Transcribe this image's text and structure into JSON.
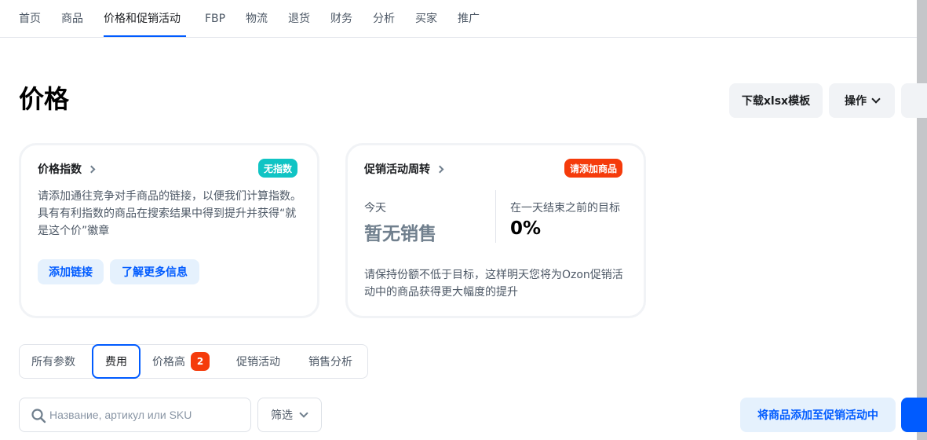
{
  "nav": {
    "tabs": [
      {
        "label": "首页"
      },
      {
        "label": "商品"
      },
      {
        "label": "价格和促销活动"
      },
      {
        "label": "FBP"
      },
      {
        "label": "物流"
      },
      {
        "label": "退货"
      },
      {
        "label": "财务"
      },
      {
        "label": "分析"
      },
      {
        "label": "买家"
      },
      {
        "label": "推广"
      }
    ],
    "active_tab": "价格和促销活动"
  },
  "header": {
    "title": "价格",
    "download_label": "下载xlsx模板",
    "actions_label": "操作"
  },
  "price_index_card": {
    "title": "价格指数",
    "badge": "无指数",
    "badge_color": "#10c4c4",
    "description": "请添加通往竞争对手商品的链接，以便我们计算指数。具有有利指数的商品在搜索结果中得到提升并获得“就是这个价”徽章",
    "add_link_label": "添加链接",
    "learn_more_label": "了解更多信息"
  },
  "promo_turnover_card": {
    "title": "促销活动周转",
    "badge": "请添加商品",
    "badge_color": "#f53b0b",
    "today_label": "今天",
    "today_value": "暂无销售",
    "target_label": "在一天结束之前的目标",
    "target_value": "0%",
    "description": "请保持份额不低于目标，这样明天您将为Ozon促销活动中的商品获得更大幅度的提升"
  },
  "filter_tabs": {
    "items": [
      {
        "label": "所有参数"
      },
      {
        "label": "费用"
      },
      {
        "label": "价格高",
        "count": "2"
      },
      {
        "label": "促销活动"
      },
      {
        "label": "销售分析"
      }
    ],
    "active": "费用"
  },
  "search": {
    "placeholder": "Название, артикул или SKU",
    "value": ""
  },
  "filter_button": {
    "label": "筛选"
  },
  "add_to_promo_button": {
    "label": "将商品添加至促销活动中"
  },
  "colors": {
    "accent": "#005bff",
    "accent_light_bg": "#e5f1fd",
    "danger": "#f53b0b",
    "teal": "#10c4c4"
  }
}
